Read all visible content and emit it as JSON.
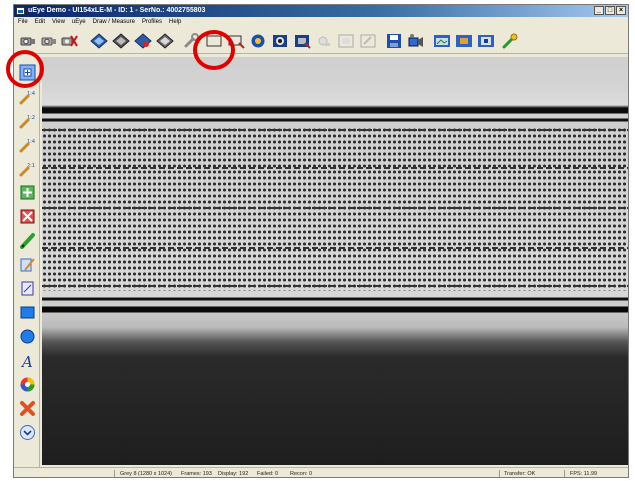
{
  "window": {
    "title": "uEye Demo - UI154xLE-M - ID: 1 - SerNo.: 4002755803",
    "minimize": "_",
    "maximize": "□",
    "close": "×"
  },
  "menu": [
    "File",
    "Edit",
    "View",
    "uEye",
    "Draw / Measure",
    "Profiles",
    "Help"
  ],
  "toolbar": {
    "buttons": [
      "camera-open",
      "camera-open-alt",
      "camera-close",
      "capture-live",
      "capture-freeze",
      "capture-stop",
      "capture-sequence",
      "properties-wrench",
      "aoi-rectangle",
      "aoi-select",
      "color-settings",
      "display-mode",
      "display-mode-alt",
      "zoom-disabled",
      "window-disabled",
      "window-disabled-alt",
      "save-image",
      "save-video",
      "view-normal",
      "view-fit",
      "view-fullscreen",
      "tools"
    ]
  },
  "left_tools": [
    "fit-to-window",
    "zoom-1-4x",
    "zoom-1-2x",
    "zoom-1-4x-alt",
    "zoom-2-1x",
    "add-region",
    "remove-region",
    "pencil-draw",
    "freehand-draw",
    "measure-tool",
    "rectangle-tool",
    "circle-tool",
    "text-tool",
    "color-picker",
    "delete-tool",
    "options-tool"
  ],
  "status": {
    "format": "Grey 8 (1280 x 1024)",
    "frames": "Frames: 193",
    "display": "Display: 192",
    "failed": "Failed: 0",
    "recon": "Recon: 0",
    "transfer": "Transfer: OK",
    "fps": "FPS: 11.99"
  },
  "colors": {
    "titlebar": "#0a246a",
    "annotation_circle": "#e00000",
    "window_bg": "#ece9d8"
  }
}
